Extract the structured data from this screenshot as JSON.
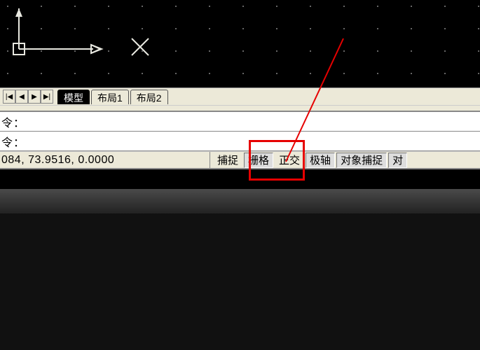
{
  "tabs": {
    "vcr": [
      "|◀",
      "◀",
      "▶",
      "▶|"
    ],
    "model": "模型",
    "layout1": "布局1",
    "layout2": "布局2"
  },
  "command": {
    "prompt1": "令：",
    "prompt2": "令："
  },
  "status": {
    "coords": "084, 73.9516, 0.0000",
    "snap": "捕捉",
    "grid": "栅格",
    "ortho": "正交",
    "polar": "极轴",
    "osnap": "对象捕捉",
    "track": "对"
  },
  "annotation": {
    "highlight_target": "grid-button"
  }
}
